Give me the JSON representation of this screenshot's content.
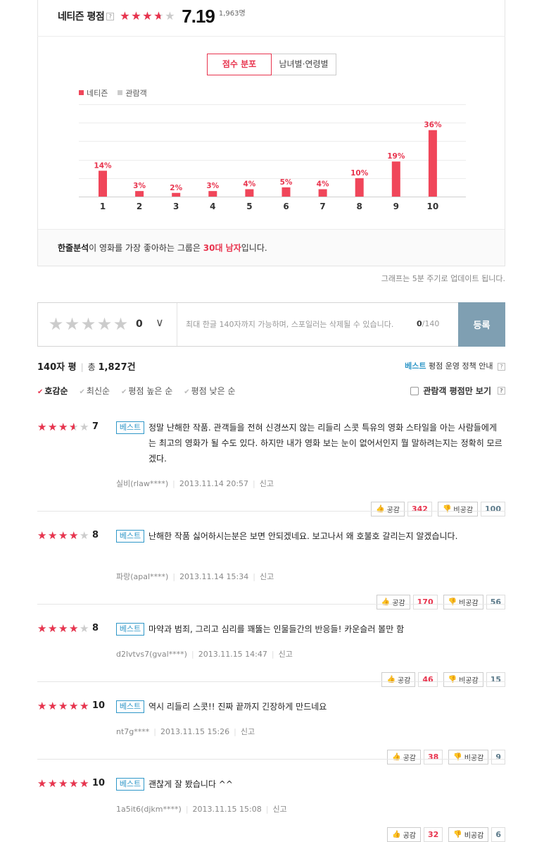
{
  "header": {
    "label": "네티즌 평점",
    "help": "?",
    "score": "7.19",
    "score_value": 7.19,
    "count": "1,963명"
  },
  "tabs": [
    {
      "label": "점수 분포",
      "active": true
    },
    {
      "label": "남녀별·연령별",
      "active": false
    }
  ],
  "legend": [
    {
      "label": "네티즌",
      "color": "#f0465a"
    },
    {
      "label": "관람객",
      "color": "#cccccc"
    }
  ],
  "chart_data": {
    "type": "bar",
    "categories": [
      "1",
      "2",
      "3",
      "4",
      "5",
      "6",
      "7",
      "8",
      "9",
      "10"
    ],
    "series": [
      {
        "name": "네티즌",
        "values": [
          14,
          3,
          2,
          3,
          4,
          5,
          4,
          10,
          19,
          36
        ],
        "color": "#f0465a"
      }
    ],
    "data_labels": [
      "14%",
      "3%",
      "2%",
      "3%",
      "4%",
      "5%",
      "4%",
      "10%",
      "19%",
      "36%"
    ],
    "ylim": [
      0,
      50
    ],
    "grid": true
  },
  "analysis": {
    "prefix": "한줄분석",
    "middle": "이 영화를 가장 좋아하는 그룹은 ",
    "group": "30대 남자",
    "suffix": "입니다."
  },
  "update_note": "그래프는 5분 주기로 업데이트 됩니다.",
  "write": {
    "score": "0",
    "placeholder": "최대 한글 140자까지 가능하며, 스포일러는 삭제될 수 있습니다.",
    "count_current": "0",
    "count_max": "/140",
    "submit": "등록"
  },
  "list": {
    "title": "140자 평",
    "total_prefix": "총",
    "total": "1,827건",
    "policy_best": "베스트",
    "policy_text": "평점 운영 정책 안내",
    "help": "?",
    "viewer_only": "관람객 평점만 보기",
    "sorts": [
      {
        "label": "호감순",
        "active": true
      },
      {
        "label": "최신순",
        "active": false
      },
      {
        "label": "평점 높은 순",
        "active": false
      },
      {
        "label": "평점 낮은 순",
        "active": false
      }
    ]
  },
  "reviews": [
    {
      "stars": 3.5,
      "score": "7",
      "tag": "베스트",
      "text": "정말 난해한 작품. 관객들을 전혀 신경쓰지 않는 리들리 스콧 특유의 영화 스타일을 아는 사람들에게는 최고의 영화가 될 수도 있다. 하지만 내가 영화 보는 눈이 없어서인지 뭘 말하려는지는 정확히 모르겠다.",
      "user": "실비(rlaw****)",
      "date": "2013.11.14 20:57",
      "report": "신고",
      "like_label": "공감",
      "likes": "342",
      "dislike_label": "비공감",
      "dislikes": "100"
    },
    {
      "stars": 4,
      "score": "8",
      "tag": "베스트",
      "text": "난해한 작품 싫어하시는분은 보면 안되겠네요. 보고나서 왜 호불호 갈리는지 알겠습니다.",
      "user": "파랑(apal****)",
      "date": "2013.11.14 15:34",
      "report": "신고",
      "like_label": "공감",
      "likes": "170",
      "dislike_label": "비공감",
      "dislikes": "56"
    },
    {
      "stars": 4,
      "score": "8",
      "tag": "베스트",
      "text": "마약과 범죄, 그리고 심리를 꽤뚫는 인물들간의 반응들! 카운슬러 볼만 함",
      "user": "d2lvtvs7(gval****)",
      "date": "2013.11.15 14:47",
      "report": "신고",
      "like_label": "공감",
      "likes": "46",
      "dislike_label": "비공감",
      "dislikes": "15"
    },
    {
      "stars": 5,
      "score": "10",
      "tag": "베스트",
      "text": "역시 리들리 스콧!! 진짜 끝까지 긴장하게 만드네요",
      "user": "nt7g****",
      "date": "2013.11.15 15:26",
      "report": "신고",
      "like_label": "공감",
      "likes": "38",
      "dislike_label": "비공감",
      "dislikes": "9"
    },
    {
      "stars": 5,
      "score": "10",
      "tag": "베스트",
      "text": "괜찮게 잘 봤습니다 ^^",
      "user": "1a5it6(djkm****)",
      "date": "2013.11.15 15:08",
      "report": "신고",
      "like_label": "공감",
      "likes": "32",
      "dislike_label": "비공감",
      "dislikes": "6"
    }
  ]
}
